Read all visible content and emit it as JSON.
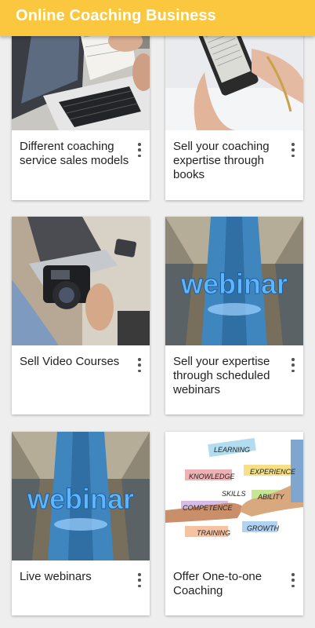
{
  "app": {
    "title": "Online Coaching Business",
    "accent": "#fbc73f"
  },
  "cards": [
    {
      "title": "Different coaching service sales models",
      "image": "laptop-notebook-photo"
    },
    {
      "title": "Sell your coaching expertise through books",
      "image": "ebook-reader-photo"
    },
    {
      "title": "Sell Video Courses",
      "image": "camera-laptop-photo"
    },
    {
      "title": "Sell your expertise through scheduled webinars",
      "image": "webinar-photo"
    },
    {
      "title": "Live webinars",
      "image": "webinar-photo"
    },
    {
      "title": "Offer One-to-one Coaching",
      "image": "handshake-skills-photo"
    }
  ],
  "webinar_word": "webinar",
  "skills_words": [
    "LEARNING",
    "KNOWLEDGE",
    "EXPERIENCE",
    "SKILLS",
    "ABILITY",
    "COMPETENCE",
    "TRAINING",
    "GROWTH"
  ]
}
